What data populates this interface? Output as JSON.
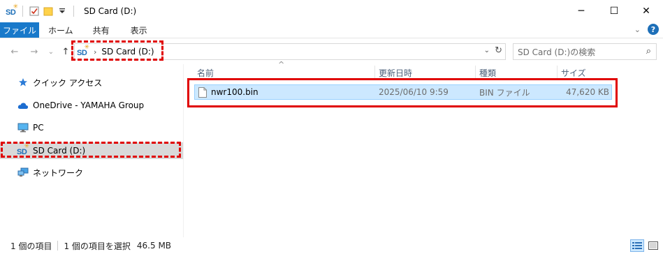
{
  "window": {
    "title": "SD Card (D:)",
    "controls": {
      "minimize": "─",
      "maximize": "☐",
      "close": "✕"
    }
  },
  "sd_icon": {
    "text": "SD",
    "spark": "✳"
  },
  "ribbon": {
    "tabs": [
      {
        "label": "ファイル"
      },
      {
        "label": "ホーム"
      },
      {
        "label": "共有"
      },
      {
        "label": "表示"
      }
    ]
  },
  "nav": {
    "back": "←",
    "forward": "→",
    "recent": "⌄",
    "up": "↑"
  },
  "address": {
    "separator": "›",
    "location": "SD Card (D:)",
    "dropdown": "⌄",
    "refresh": "↻"
  },
  "search": {
    "placeholder": "SD Card (D:)の検索",
    "icon": "⌕"
  },
  "navpane": {
    "items": [
      {
        "label": "クイック アクセス",
        "icon": "star-icon"
      },
      {
        "label": "OneDrive - YAMAHA Group",
        "icon": "cloud-icon"
      },
      {
        "label": "PC",
        "icon": "computer-icon"
      },
      {
        "label": "SD Card (D:)",
        "icon": "sd-card-icon",
        "selected": true
      },
      {
        "label": "ネットワーク",
        "icon": "network-icon"
      }
    ]
  },
  "filelist": {
    "sort_indicator": "^",
    "columns": [
      "名前",
      "更新日時",
      "種類",
      "サイズ"
    ],
    "rows": [
      {
        "name": "nwr100.bin",
        "modified": "2025/06/10 9:59",
        "type": "BIN ファイル",
        "size": "47,620 KB",
        "selected": true
      }
    ]
  },
  "status": {
    "item_count": "1 個の項目",
    "selection": "1 個の項目を選択",
    "selection_size": "46.5 MB"
  },
  "colors": {
    "accent": "#1979ca",
    "selection_bg": "#cce8ff",
    "selection_border": "#99d1ff",
    "highlight_red": "#e00000"
  }
}
